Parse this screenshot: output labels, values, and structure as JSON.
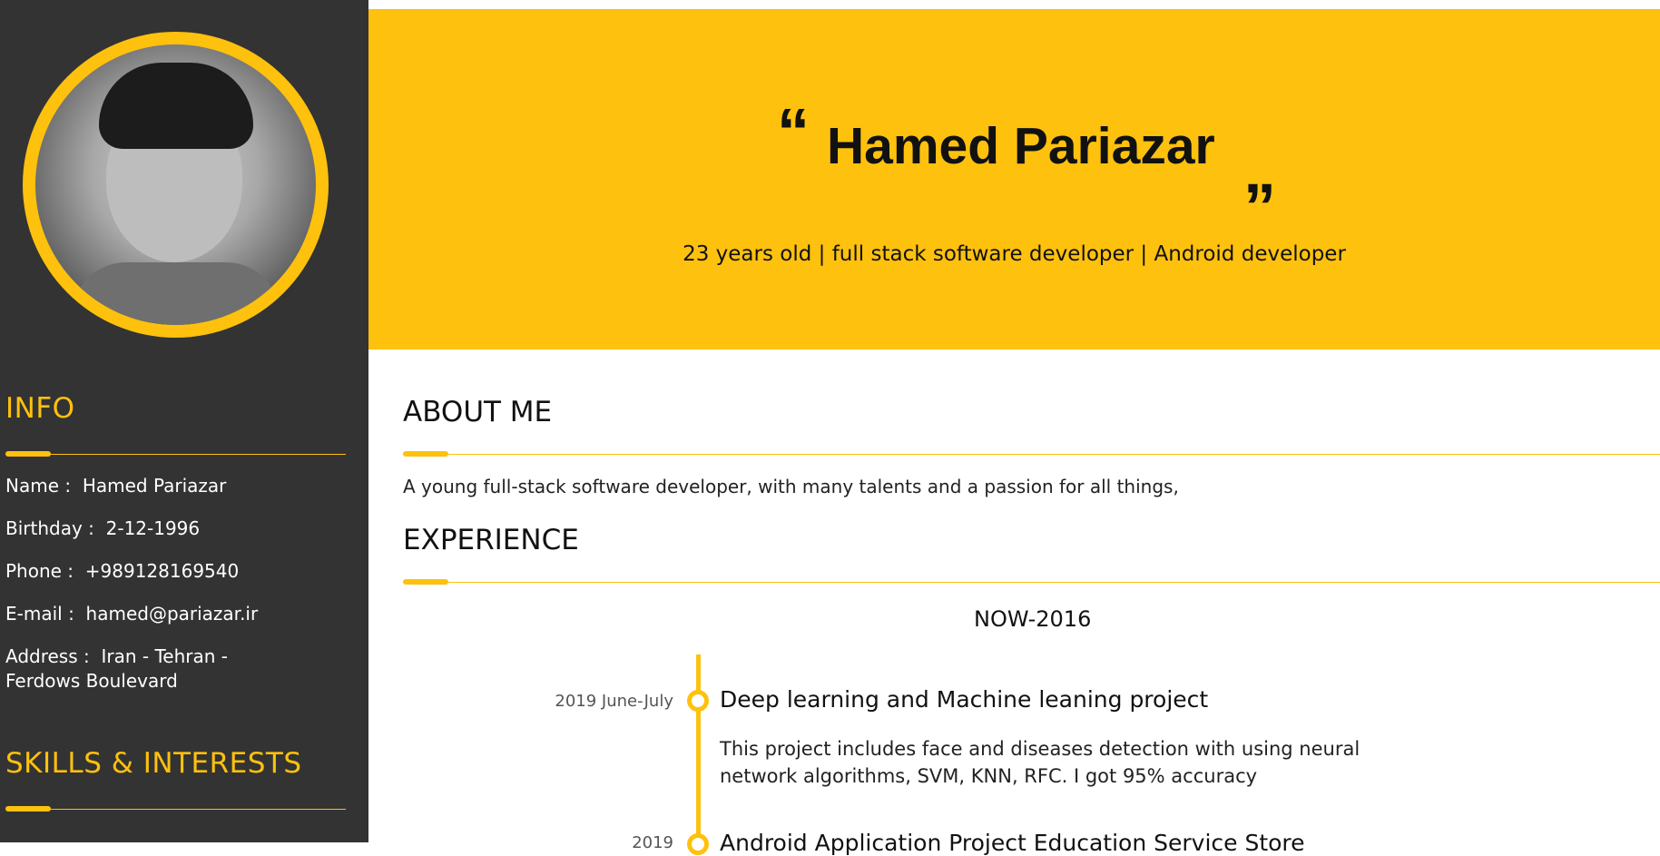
{
  "sidebar": {
    "info_title": "INFO",
    "info": [
      {
        "label": "Name",
        "value": "Hamed Pariazar"
      },
      {
        "label": "Birthday",
        "value": "2-12-1996"
      },
      {
        "label": "Phone",
        "value": "+989128169540"
      },
      {
        "label": "E-mail",
        "value": "hamed@pariazar.ir"
      },
      {
        "label": "Address",
        "value": "Iran - Tehran - Ferdows Boulevard"
      }
    ],
    "skills_title": "SKILLS & INTERESTS"
  },
  "hero": {
    "quote_open": "“",
    "name": "Hamed Pariazar",
    "quote_close": "„",
    "tagline": "23 years old | full stack software developer | Android developer"
  },
  "about": {
    "title": "ABOUT ME",
    "text": "A young full-stack software developer, with many talents and a passion for all things,"
  },
  "experience": {
    "title": "EXPERIENCE",
    "period": "NOW-2016",
    "items": [
      {
        "date": "2019 June-July",
        "title": "Deep learning and Machine leaning project",
        "description": "This project includes face and diseases detection with using neural network algorithms, SVM, KNN, RFC. I got 95% accuracy"
      },
      {
        "date": "2019",
        "title": "Android Application Project Education Service Store",
        "description": ""
      }
    ]
  },
  "colors": {
    "accent": "#FDC10E",
    "sidebar_bg": "#333333"
  }
}
